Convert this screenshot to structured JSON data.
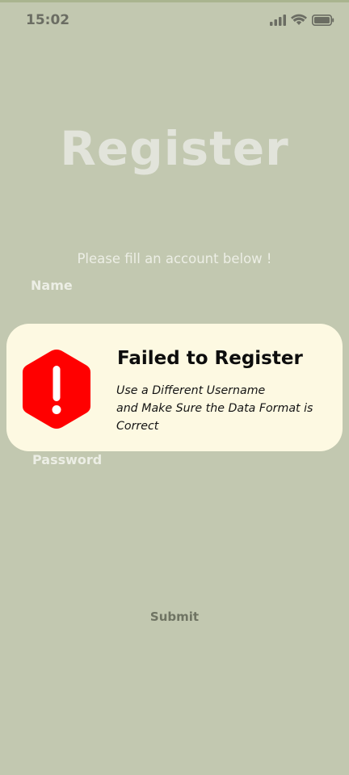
{
  "status_bar": {
    "time": "15:02",
    "icons": [
      "signal-icon",
      "wifi-icon",
      "battery-icon"
    ]
  },
  "page": {
    "title": "Register",
    "subtitle": "Please fill an account below !",
    "name_label": "Name",
    "password_label": "Password",
    "submit_label": "Submit"
  },
  "alert": {
    "icon": "alert-hexagon-icon",
    "title": "Failed to Register",
    "message_lines": [
      "Use a Different Username",
      "and Make Sure the Data Format is",
      "Correct"
    ]
  },
  "colors": {
    "background": "#c2c8b0",
    "alert_background": "#fdf9e2",
    "alert_icon": "#ff0000"
  }
}
